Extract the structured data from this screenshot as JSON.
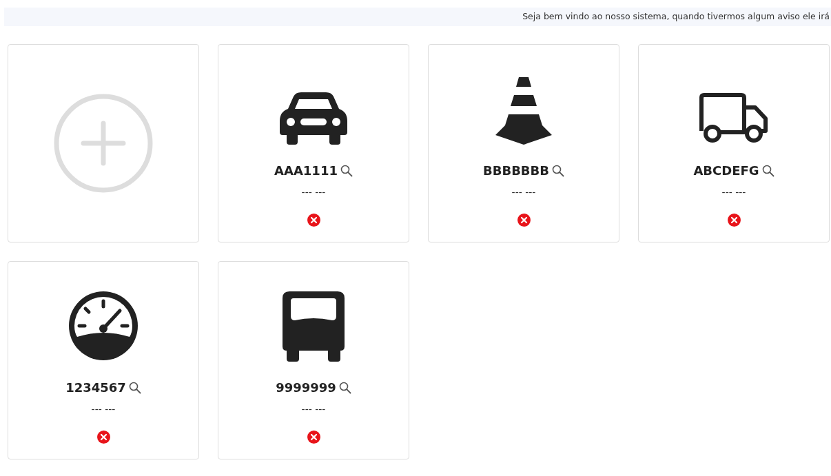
{
  "notice": {
    "text": "Seja bem vindo ao nosso sistema, quando tivermos algum aviso ele irá"
  },
  "add_card": {
    "kind": "add"
  },
  "vehicles": [
    {
      "kind": "car",
      "plate": "AAA1111",
      "subtitle": "--- ---",
      "error": true
    },
    {
      "kind": "cone",
      "plate": "BBBBBBB",
      "subtitle": "--- ---",
      "error": true
    },
    {
      "kind": "truck",
      "plate": "ABCDEFG",
      "subtitle": "--- ---",
      "error": true
    },
    {
      "kind": "gauge",
      "plate": "1234567",
      "subtitle": "--- ---",
      "error": true
    },
    {
      "kind": "bus",
      "plate": "9999999",
      "subtitle": "--- ---",
      "error": true
    }
  ]
}
